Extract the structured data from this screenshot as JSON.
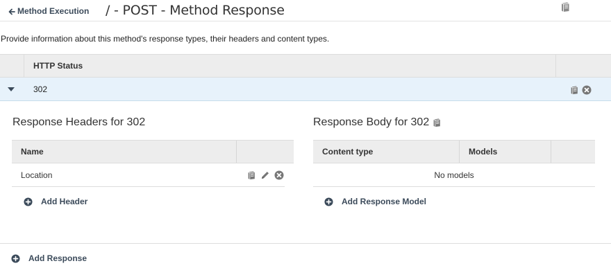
{
  "header": {
    "back_label": "Method Execution",
    "title": "/ - POST - Method Response"
  },
  "description": "Provide information about this method's response types, their headers and content types.",
  "status_table": {
    "column_header": "HTTP Status",
    "rows": [
      {
        "code": "302"
      }
    ]
  },
  "response_headers": {
    "title": "Response Headers for 302",
    "columns": [
      "Name",
      ""
    ],
    "rows": [
      {
        "name": "Location"
      }
    ],
    "add_label": "Add Header"
  },
  "response_body": {
    "title": "Response Body for 302",
    "columns": [
      "Content type",
      "Models",
      ""
    ],
    "empty_text": "No models",
    "add_label": "Add Response Model"
  },
  "add_response_label": "Add Response",
  "icons": {
    "docs": "book-icon",
    "delete": "circle-x-icon",
    "edit": "pencil-icon",
    "add": "circle-plus-icon",
    "expand": "caret-down-icon",
    "back": "arrow-left-icon"
  },
  "colors": {
    "selected_row": "#e7f2fb",
    "table_header": "#ededed",
    "link": "#3b4a5a",
    "icon": "#666666"
  }
}
